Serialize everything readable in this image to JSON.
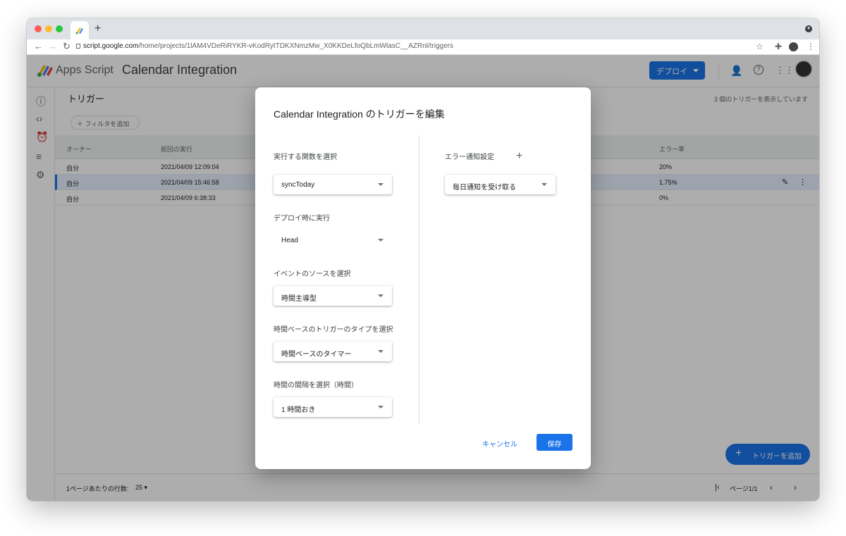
{
  "browser": {
    "url_host": "script.google.com",
    "url_path": "/home/projects/1lAM4VDeRiRYKR-vKodRytTDKXNmzMw_X0KKDeLfoQbLmWlasC__AZRnl/triggers",
    "new_tab_label": "+"
  },
  "app": {
    "name": "Apps Script",
    "project_title": "Calendar Integration",
    "deploy_label": "デプロイ"
  },
  "triggers_page": {
    "title": "トリガー",
    "count_text": "3 個のトリガーを表示しています",
    "filter_label": "フィルタを追加",
    "columns": [
      "オーナー",
      "前回の実行",
      "エラー率"
    ],
    "rows": [
      {
        "owner": "自分",
        "last_run": "2021/04/09 12:09:04",
        "error_rate": "20%"
      },
      {
        "owner": "自分",
        "last_run": "2021/04/09 15:46:58",
        "error_rate": "1.75%"
      },
      {
        "owner": "自分",
        "last_run": "2021/04/09 6:38:33",
        "error_rate": "0%"
      }
    ],
    "rows_per_page_label": "1ページあたりの行数:",
    "rows_per_page_value": "25",
    "page_label": "ページ1/1",
    "add_trigger_label": "トリガーを追加"
  },
  "dialog": {
    "title": "Calendar Integration のトリガーを編集",
    "function_label": "実行する関数を選択",
    "function_value": "syncToday",
    "deploy_label": "デプロイ時に実行",
    "deploy_value": "Head",
    "event_source_label": "イベントのソースを選択",
    "event_source_value": "時間主導型",
    "trigger_type_label": "時間ベースのトリガーのタイプを選択",
    "trigger_type_value": "時間ベースのタイマー",
    "interval_label": "時間の間隔を選択（時間）",
    "interval_value": "1 時間おき",
    "error_notify_label": "エラー通知設定",
    "error_notify_value": "毎日通知を受け取る",
    "cancel_label": "キャンセル",
    "save_label": "保存"
  },
  "colors": {
    "accent": "#1a73e8",
    "scrim": "rgba(0,0,0,0.32)"
  }
}
